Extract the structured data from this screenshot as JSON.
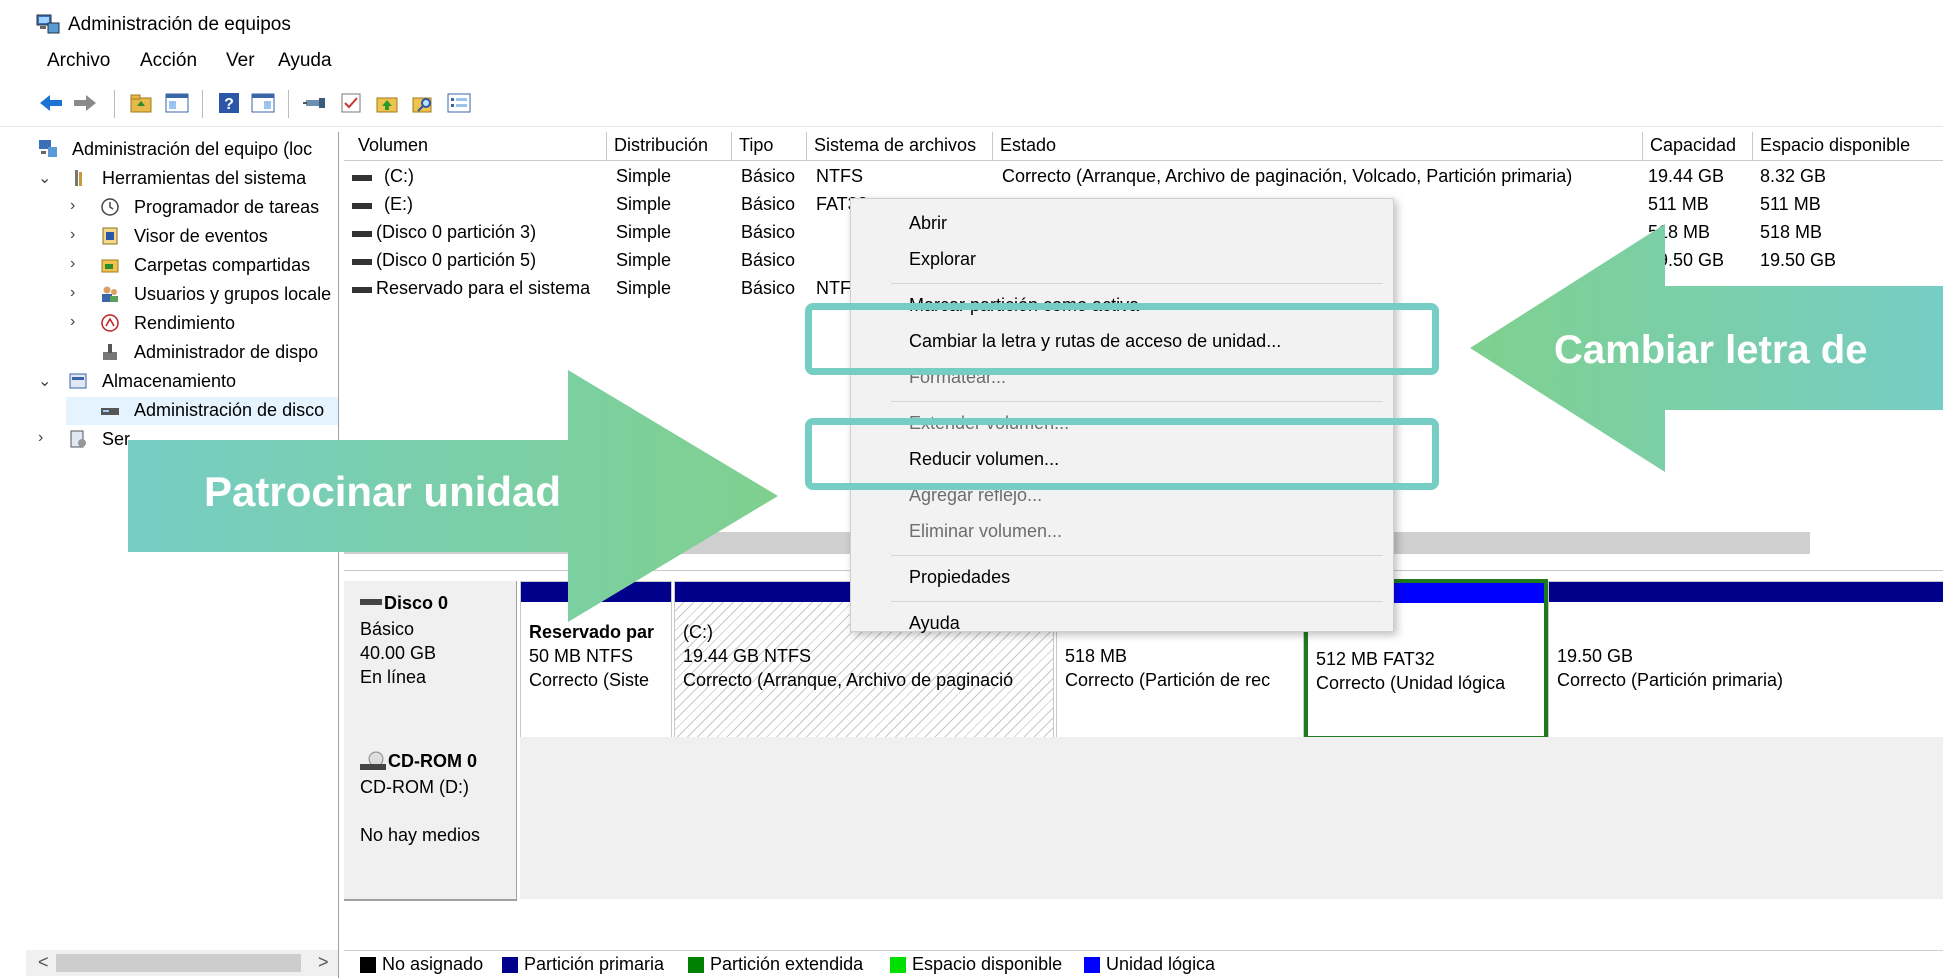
{
  "window": {
    "title": "Administración de equipos"
  },
  "menu": [
    "Archivo",
    "Acción",
    "Ver",
    "Ayuda"
  ],
  "toolbar_icons": [
    "back-arrow-icon",
    "forward-arrow-icon",
    "up-folder-icon",
    "show-hide-tree-icon",
    "help-icon",
    "view-icon",
    "connect-icon",
    "check-icon",
    "folder-up-icon",
    "search-folder-icon",
    "list-icon"
  ],
  "tree": {
    "items": [
      {
        "label": "Administración del equipo (loc",
        "icon": "computer-icon"
      },
      {
        "label": "Herramientas del sistema",
        "icon": "tools-icon"
      },
      {
        "label": "Programador de tareas",
        "icon": "clock-icon"
      },
      {
        "label": "Visor de eventos",
        "icon": "event-viewer-icon"
      },
      {
        "label": "Carpetas compartidas",
        "icon": "shared-folders-icon"
      },
      {
        "label": "Usuarios y grupos locale",
        "icon": "users-icon"
      },
      {
        "label": "Rendimiento",
        "icon": "performance-icon"
      },
      {
        "label": "Administrador de dispo",
        "icon": "device-manager-icon"
      },
      {
        "label": "Almacenamiento",
        "icon": "storage-icon"
      },
      {
        "label": "Administración de disco",
        "icon": "disk-management-icon"
      },
      {
        "label": "Ser",
        "icon": "services-icon"
      }
    ],
    "scroll_left": "<",
    "scroll_right": ">"
  },
  "volume_table": {
    "headers": [
      "Volumen",
      "Distribución",
      "Tipo",
      "Sistema de archivos",
      "Estado",
      "Capacidad",
      "Espacio disponible"
    ],
    "rows": [
      [
        "(C:)",
        "Simple",
        "Básico",
        "NTFS",
        "Correcto (Arranque, Archivo de paginación, Volcado, Partición primaria)",
        "19.44 GB",
        "8.32 GB"
      ],
      [
        "(E:)",
        "Simple",
        "Básico",
        "FAT32",
        "",
        "511 MB",
        "511 MB"
      ],
      [
        "(Disco 0 partición 3)",
        "Simple",
        "Básico",
        "",
        "",
        "518 MB",
        "518 MB"
      ],
      [
        "(Disco 0 partición 5)",
        "Simple",
        "Básico",
        "",
        "",
        "19.50 GB",
        "19.50 GB"
      ],
      [
        "Reservado para el sistema",
        "Simple",
        "Básico",
        "NTFS",
        "",
        "",
        ""
      ]
    ]
  },
  "disk0": {
    "name": "Disco 0",
    "type": "Básico",
    "size": "40.00 GB",
    "status": "En línea",
    "partitions": [
      {
        "title": "Reservado par",
        "size": "50 MB NTFS",
        "status": "Correcto (Siste"
      },
      {
        "title": "(C:)",
        "size": "19.44 GB NTFS",
        "status": "Correcto (Arranque, Archivo de paginació"
      },
      {
        "title": "",
        "size": "518 MB",
        "status": "Correcto (Partición de rec"
      },
      {
        "title": "",
        "size": "512 MB FAT32",
        "status": "Correcto (Unidad lógica"
      },
      {
        "title": "",
        "size": "19.50 GB",
        "status": "Correcto (Partición primaria)"
      }
    ]
  },
  "cdrom": {
    "name": "CD-ROM 0",
    "drive": "CD-ROM (D:)",
    "status": "No hay medios"
  },
  "legend": [
    {
      "label": "No asignado",
      "color": "#000000"
    },
    {
      "label": "Partición primaria",
      "color": "#00008b"
    },
    {
      "label": "Partición extendida",
      "color": "#008000"
    },
    {
      "label": "Espacio disponible",
      "color": "#00e000"
    },
    {
      "label": "Unidad lógica",
      "color": "#0000ff"
    }
  ],
  "context_menu": {
    "items": [
      {
        "label": "Abrir",
        "enabled": true
      },
      {
        "label": "Explorar",
        "enabled": true
      },
      {
        "label": "Marcar partición como activa",
        "enabled": true
      },
      {
        "label": "Cambiar la letra y rutas de acceso de unidad...",
        "enabled": true
      },
      {
        "label": "Formatear...",
        "enabled": false
      },
      {
        "label": "Extender volumen...",
        "enabled": false
      },
      {
        "label": "Reducir volumen...",
        "enabled": true
      },
      {
        "label": "Agregar reflejo...",
        "enabled": false
      },
      {
        "label": "Eliminar volumen...",
        "enabled": false
      },
      {
        "label": "Propiedades",
        "enabled": true
      },
      {
        "label": "Ayuda",
        "enabled": true
      }
    ]
  },
  "annotations": {
    "left_arrow_text": "Patrocinar unidad",
    "right_arrow_text": "Cambiar letra de",
    "arrow_color": "#76cdc4",
    "highlight_color": "#76cdc4"
  }
}
